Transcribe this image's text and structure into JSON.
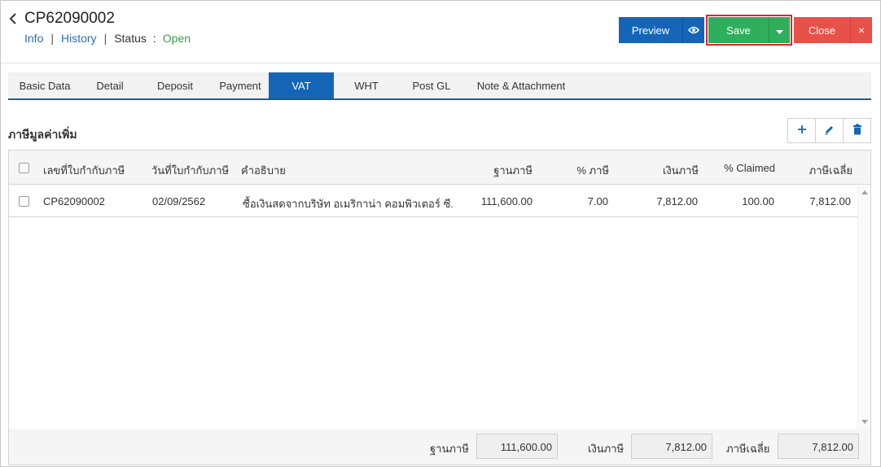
{
  "header": {
    "doc_no": "CP62090002",
    "nav": {
      "info": "Info",
      "history": "History",
      "status_label": "Status",
      "colon": ":",
      "status_value": "Open",
      "sep": "|"
    },
    "buttons": {
      "preview": "Preview",
      "save": "Save",
      "close": "Close",
      "close_x": "×"
    }
  },
  "tabs": [
    "Basic Data",
    "Detail",
    "Deposit",
    "Payment",
    "VAT",
    "WHT",
    "Post GL",
    "Note & Attachment"
  ],
  "active_tab": "VAT",
  "section": {
    "title": "ภาษีมูลค่าเพิ่ม"
  },
  "grid": {
    "columns": {
      "invoice_no": "เลขที่ใบกำกับภาษี",
      "invoice_date": "วันที่ใบกำกับภาษี",
      "description": "คำอธิบาย",
      "tax_base": "ฐานภาษี",
      "tax_pct": "% ภาษี",
      "tax_amount": "เงินภาษี",
      "claimed_pct": "% Claimed",
      "avg_tax": "ภาษีเฉลี่ย"
    },
    "rows": [
      {
        "invoice_no": "CP62090002",
        "invoice_date": "02/09/2562",
        "description": "ซื้อเงินสดจากบริษัท อเมริกาน่า คอมพิวเตอร์ ซี...",
        "tax_base": "111,600.00",
        "tax_pct": "7.00",
        "tax_amount": "7,812.00",
        "claimed_pct": "100.00",
        "avg_tax": "7,812.00"
      }
    ]
  },
  "totals": {
    "tax_base_label": "ฐานภาษี",
    "tax_base_value": "111,600.00",
    "tax_amount_label": "เงินภาษี",
    "tax_amount_value": "7,812.00",
    "avg_tax_label": "ภาษีเฉลี่ย",
    "avg_tax_value": "7,812.00"
  },
  "colors": {
    "primary": "#1565b7",
    "success": "#2fae5c",
    "danger": "#e8514a",
    "status_open": "#3c9a4b",
    "link": "#2a6fb6"
  },
  "icons": [
    "chevron-left-icon",
    "eye-icon",
    "caret-down-icon",
    "close-icon",
    "plus-icon",
    "pencil-icon",
    "trash-icon"
  ]
}
